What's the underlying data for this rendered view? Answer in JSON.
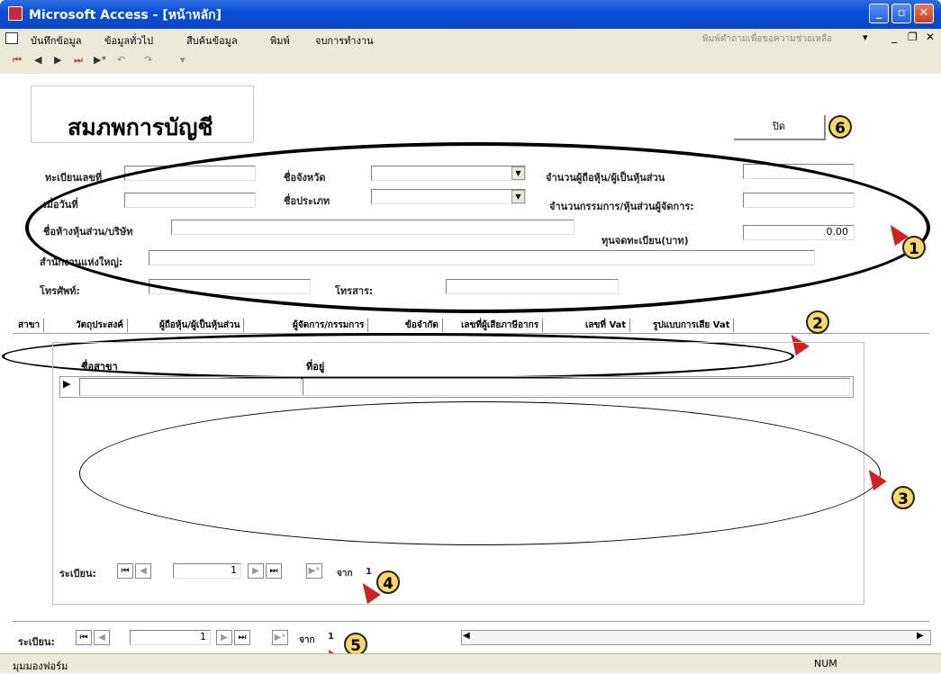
{
  "window": {
    "title": "Microsoft Access - [หน้าหลัก]"
  },
  "menu": {
    "items": [
      "บันทึกข้อมูล",
      "ข้อมูลทั่วไป",
      "สืบค้นข้อมูล",
      "พิมพ์",
      "จบการทำงาน"
    ],
    "help_placeholder": "พิมพ์คำถามเพื่อขอความช่วยเหลือ"
  },
  "toolbar": {
    "icons": [
      "first-record",
      "prev-record",
      "next-record",
      "last-record",
      "new-record",
      "undo",
      "redo"
    ]
  },
  "form": {
    "title": "สมภพการบัญชี",
    "close_label": "ปิด",
    "fields": {
      "reg_no_label": "ทะเบียนเลขที่",
      "reg_date_label": "เมื่อวันที่",
      "company_label": "ชื่อห้างหุ้นส่วน/บริษัท",
      "hq_label": "สำนักงานแห่งใหญ่:",
      "phone_label": "โทรศัพท์:",
      "fax_label": "โทรสาร:",
      "province_label": "ชื่อจังหวัด",
      "type_label": "ชื่อประเภท",
      "shareholders_label": "จำนวนผู้ถือหุ้น/ผู้เป็นหุ้นส่วน",
      "directors_label": "จำนวนกรรมการ/หุ้นส่วนผู้จัดการ:",
      "capital_label": "ทุนจดทะเบียน(บาท)",
      "capital_value": "0.00"
    }
  },
  "tabs": [
    "สาขา",
    "วัตถุประสงค์",
    "ผู้ถือหุ้น/ผู้เป็นหุ้นส่วน",
    "ผู้จัดการ/กรรมการ",
    "ข้อจำกัด",
    "เลขที่ผู้เสียภาษีอากร",
    "เลขที่ Vat",
    "รูปแบบการเสีย Vat"
  ],
  "subform": {
    "columns": [
      "ชื่อสาขา",
      "ที่อยู่"
    ],
    "nav_label": "ระเบียน:",
    "record_no": "1",
    "of_label": "จาก",
    "of_value": "1"
  },
  "main_nav": {
    "label": "ระเบียน:",
    "record_no": "1",
    "of_label": "จาก",
    "of_value": "1"
  },
  "status": {
    "left": "มุมมองฟอร์ม",
    "right": "NUM"
  },
  "callouts": [
    "1",
    "2",
    "3",
    "4",
    "5",
    "6"
  ],
  "colors": {
    "titlebar": "#0a4fd8",
    "callout": "#f7d969",
    "arrow": "#d21f1f"
  }
}
